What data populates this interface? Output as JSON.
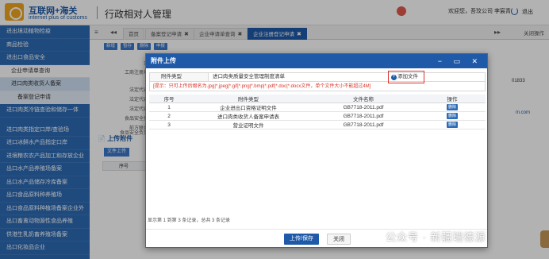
{
  "header": {
    "logo_title": "互联网+海关",
    "logo_subtitle": "internet plus of customs",
    "app_title": "行政相对人管理",
    "welcome": "欢迎您，吾玟公司 李宸青",
    "logout": "退出"
  },
  "sidebar": {
    "items": [
      "进出境动植物检疫",
      "商品检验",
      "进出口食品安全",
      "企业申请单查询",
      "进口肉类收货人备案",
      "备案登记申请",
      "进口肉类冷链查验和储存一体",
      "进口肉类指定口岸/查验场",
      "进口冰鲜水产品指定口岸",
      "进境粮农农产品加工和存放企业",
      "出口水产品养殖场备案",
      "出口水产品储存冷库备案",
      "出口食品原料种养殖场",
      "出口食品原料种植场备案企业外",
      "出口畜禽动物源性食品养殖",
      "供港生乳奶畜养殖场备案",
      "出口化妆品企业"
    ]
  },
  "tabs": {
    "home": "首页",
    "items": [
      {
        "label": "备案登记申请"
      },
      {
        "label": "企业申请单查询"
      },
      {
        "label": "企业注册登记申请"
      }
    ],
    "close_ops": "关闭操作"
  },
  "background": {
    "mini_buttons": [
      "新增",
      "暂存",
      "删除",
      "申报"
    ],
    "labels": [
      "企业",
      "工商注册地址",
      "法定代表人",
      "法定代表人",
      "法定代表人",
      "食品安全负责",
      "前方联系人",
      "食品安全负责人"
    ],
    "number": "01833",
    "link": "m.com",
    "attach_section": "上传附件",
    "attach_button": "文件上传",
    "table_head": "序号"
  },
  "modal": {
    "title": "附件上传",
    "controls": "− ▭ ✕",
    "form_label": "附件类型",
    "selected_type": "进口肉类质量安全管理制度清单",
    "add_file": "添加文件",
    "tip": "[提示：只可上传后缀名为.jpg|*.jpeg|*.gif|*.png|*.bmp|*.pdf|*.doc|*.docx文件，单个文件大小不能超过4M]",
    "columns": [
      "序号",
      "附件类型",
      "文件名称",
      "操作"
    ],
    "rows": [
      {
        "no": "1",
        "type": "企业进出口资格证明文件",
        "file": "GB7718-2011.pdf",
        "op": "删除"
      },
      {
        "no": "2",
        "type": "进口肉类收货人备案申请表",
        "file": "GB7718-2011.pdf",
        "op": "删除"
      },
      {
        "no": "3",
        "type": "营业证明文件",
        "file": "GB7718-2011.pdf",
        "op": "删除"
      }
    ],
    "records": "显示第 1 到第 3 条记录，总共 3 条记录",
    "save": "上传/保存",
    "close": "关闭"
  },
  "watermark": {
    "text": "公众号 · 新疆瑞德源",
    "icon": "wechat-icon"
  },
  "colors": {
    "primary": "#1e5aa8",
    "sidebar": "#2d6bb5",
    "warning": "#d9352b",
    "logo": "#f1a51d"
  }
}
